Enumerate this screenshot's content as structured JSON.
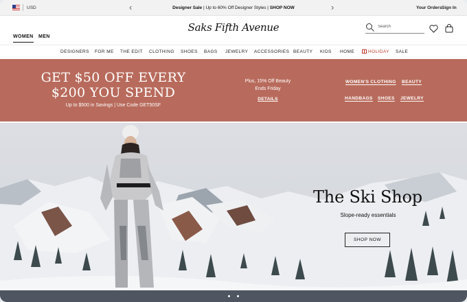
{
  "promo_strip": {
    "currency": "USD",
    "message_bold_1": "Designer Sale",
    "message_text": " | Up to 60% Off Designer Styles | ",
    "message_bold_2": "SHOP NOW",
    "prev_icon": "chevron-left-icon",
    "next_icon": "chevron-right-icon",
    "links": [
      "Your Orders",
      "Sign In"
    ]
  },
  "header": {
    "genders": [
      "WOMEN",
      "MEN"
    ],
    "active_gender": "WOMEN",
    "logo_text": "Saks Fifth Avenue",
    "search_placeholder": "Search",
    "icons": [
      "search-icon",
      "heart-icon",
      "shopping-bag-icon"
    ]
  },
  "category_nav": {
    "items": [
      "DESIGNERS",
      "FOR ME",
      "THE EDIT",
      "CLOTHING",
      "SHOES",
      "BAGS",
      "JEWELRY",
      "ACCESSORIES",
      "BEAUTY",
      "KIDS",
      "HOME",
      "HOLIDAY",
      "SALE"
    ],
    "holiday_color": "#c0392b"
  },
  "sale_banner": {
    "title": "GET $50 OFF EVERY\n$200 YOU SPEND",
    "subtitle": "Up to $500 in Savings | Use Code GET50SF",
    "beauty_line_1": "Plus, 15% Off Beauty",
    "beauty_line_2": "Ends Friday",
    "details_label": "DETAILS",
    "shop_links": [
      "WOMEN'S CLOTHING",
      "BEAUTY",
      "HANDBAGS",
      "SHOES",
      "JEWELRY"
    ],
    "background_color": "#b86b5c"
  },
  "hero": {
    "title": "The Ski Shop",
    "subtitle": "Slope-ready essentials",
    "button_label": "SHOP NOW",
    "carousel_dots": 2
  }
}
